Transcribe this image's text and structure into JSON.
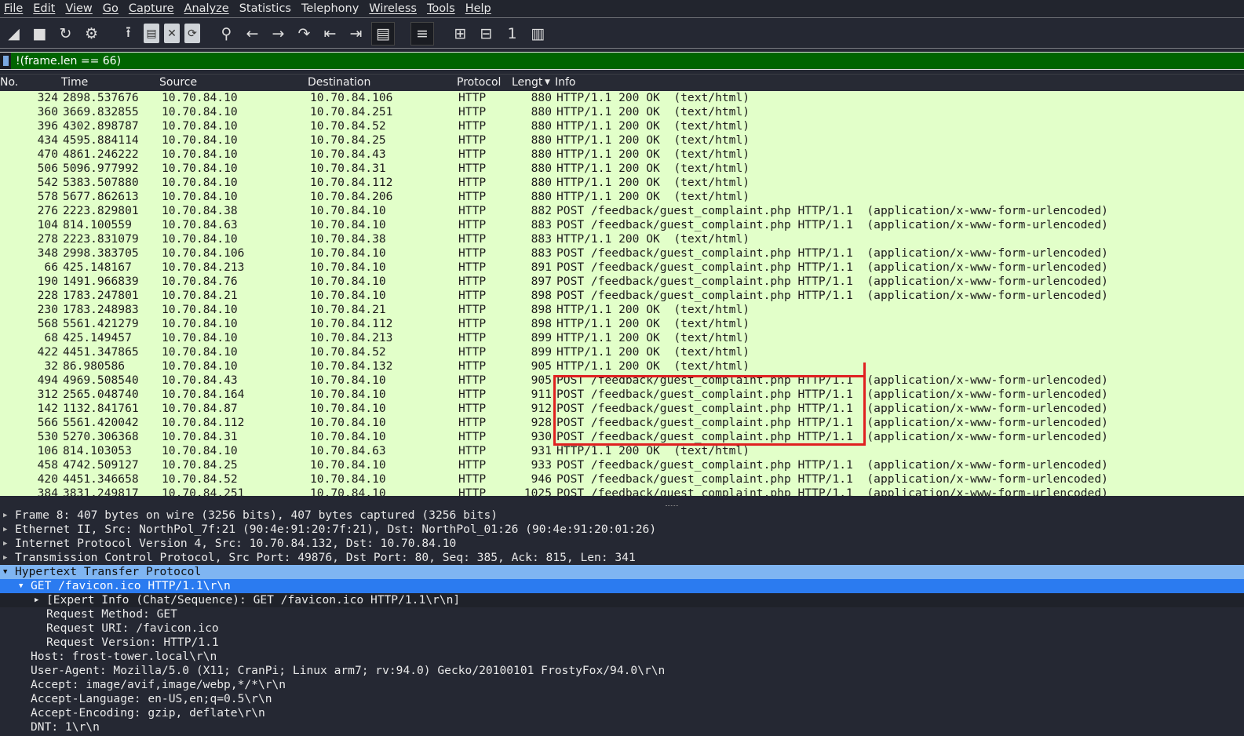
{
  "menu": [
    "File",
    "Edit",
    "View",
    "Go",
    "Capture",
    "Analyze",
    "Statistics",
    "Telephony",
    "Wireless",
    "Tools",
    "Help"
  ],
  "toolbar_icons": [
    "shark-fin-start-icon",
    "stop-icon",
    "restart-icon",
    "options-gear-icon",
    "open-file-icon",
    "file-icon",
    "close-file-icon",
    "reload-file-icon",
    "search-icon",
    "back-arrow-icon",
    "forward-arrow-icon",
    "go-to-packet-icon",
    "first-packet-icon",
    "last-packet-icon",
    "autoscroll-icon",
    "colorize-icon",
    "zoom-in-icon",
    "zoom-out-icon",
    "normal-size-icon",
    "resize-columns-icon"
  ],
  "filter": {
    "value": "!(frame.len == 66)"
  },
  "columns": {
    "no": "No.",
    "time": "Time",
    "source": "Source",
    "destination": "Destination",
    "protocol": "Protocol",
    "length": "Lengt",
    "info": "Info"
  },
  "packets": [
    [
      "324",
      "2898.537676",
      "10.70.84.10",
      "10.70.84.106",
      "HTTP",
      "880",
      "HTTP/1.1 200 OK  (text/html)"
    ],
    [
      "360",
      "3669.832855",
      "10.70.84.10",
      "10.70.84.251",
      "HTTP",
      "880",
      "HTTP/1.1 200 OK  (text/html)"
    ],
    [
      "396",
      "4302.898787",
      "10.70.84.10",
      "10.70.84.52",
      "HTTP",
      "880",
      "HTTP/1.1 200 OK  (text/html)"
    ],
    [
      "434",
      "4595.884114",
      "10.70.84.10",
      "10.70.84.25",
      "HTTP",
      "880",
      "HTTP/1.1 200 OK  (text/html)"
    ],
    [
      "470",
      "4861.246222",
      "10.70.84.10",
      "10.70.84.43",
      "HTTP",
      "880",
      "HTTP/1.1 200 OK  (text/html)"
    ],
    [
      "506",
      "5096.977992",
      "10.70.84.10",
      "10.70.84.31",
      "HTTP",
      "880",
      "HTTP/1.1 200 OK  (text/html)"
    ],
    [
      "542",
      "5383.507880",
      "10.70.84.10",
      "10.70.84.112",
      "HTTP",
      "880",
      "HTTP/1.1 200 OK  (text/html)"
    ],
    [
      "578",
      "5677.862613",
      "10.70.84.10",
      "10.70.84.206",
      "HTTP",
      "880",
      "HTTP/1.1 200 OK  (text/html)"
    ],
    [
      "276",
      "2223.829801",
      "10.70.84.38",
      "10.70.84.10",
      "HTTP",
      "882",
      "POST /feedback/guest_complaint.php HTTP/1.1  (application/x-www-form-urlencoded)"
    ],
    [
      "104",
      "814.100559",
      "10.70.84.63",
      "10.70.84.10",
      "HTTP",
      "883",
      "POST /feedback/guest_complaint.php HTTP/1.1  (application/x-www-form-urlencoded)"
    ],
    [
      "278",
      "2223.831079",
      "10.70.84.10",
      "10.70.84.38",
      "HTTP",
      "883",
      "HTTP/1.1 200 OK  (text/html)"
    ],
    [
      "348",
      "2998.383705",
      "10.70.84.106",
      "10.70.84.10",
      "HTTP",
      "883",
      "POST /feedback/guest_complaint.php HTTP/1.1  (application/x-www-form-urlencoded)"
    ],
    [
      "66",
      "425.148167",
      "10.70.84.213",
      "10.70.84.10",
      "HTTP",
      "891",
      "POST /feedback/guest_complaint.php HTTP/1.1  (application/x-www-form-urlencoded)"
    ],
    [
      "190",
      "1491.966839",
      "10.70.84.76",
      "10.70.84.10",
      "HTTP",
      "897",
      "POST /feedback/guest_complaint.php HTTP/1.1  (application/x-www-form-urlencoded)"
    ],
    [
      "228",
      "1783.247801",
      "10.70.84.21",
      "10.70.84.10",
      "HTTP",
      "898",
      "POST /feedback/guest_complaint.php HTTP/1.1  (application/x-www-form-urlencoded)"
    ],
    [
      "230",
      "1783.248983",
      "10.70.84.10",
      "10.70.84.21",
      "HTTP",
      "898",
      "HTTP/1.1 200 OK  (text/html)"
    ],
    [
      "568",
      "5561.421279",
      "10.70.84.10",
      "10.70.84.112",
      "HTTP",
      "898",
      "HTTP/1.1 200 OK  (text/html)"
    ],
    [
      "68",
      "425.149457",
      "10.70.84.10",
      "10.70.84.213",
      "HTTP",
      "899",
      "HTTP/1.1 200 OK  (text/html)"
    ],
    [
      "422",
      "4451.347865",
      "10.70.84.10",
      "10.70.84.52",
      "HTTP",
      "899",
      "HTTP/1.1 200 OK  (text/html)"
    ],
    [
      "32",
      "86.980586",
      "10.70.84.10",
      "10.70.84.132",
      "HTTP",
      "905",
      "HTTP/1.1 200 OK  (text/html)"
    ],
    [
      "494",
      "4969.508540",
      "10.70.84.43",
      "10.70.84.10",
      "HTTP",
      "905",
      "POST /feedback/guest_complaint.php HTTP/1.1  (application/x-www-form-urlencoded)"
    ],
    [
      "312",
      "2565.048740",
      "10.70.84.164",
      "10.70.84.10",
      "HTTP",
      "911",
      "POST /feedback/guest_complaint.php HTTP/1.1  (application/x-www-form-urlencoded)"
    ],
    [
      "142",
      "1132.841761",
      "10.70.84.87",
      "10.70.84.10",
      "HTTP",
      "912",
      "POST /feedback/guest_complaint.php HTTP/1.1  (application/x-www-form-urlencoded)"
    ],
    [
      "566",
      "5561.420042",
      "10.70.84.112",
      "10.70.84.10",
      "HTTP",
      "928",
      "POST /feedback/guest_complaint.php HTTP/1.1  (application/x-www-form-urlencoded)"
    ],
    [
      "530",
      "5270.306368",
      "10.70.84.31",
      "10.70.84.10",
      "HTTP",
      "930",
      "POST /feedback/guest_complaint.php HTTP/1.1  (application/x-www-form-urlencoded)"
    ],
    [
      "106",
      "814.103053",
      "10.70.84.10",
      "10.70.84.63",
      "HTTP",
      "931",
      "HTTP/1.1 200 OK  (text/html)"
    ],
    [
      "458",
      "4742.509127",
      "10.70.84.25",
      "10.70.84.10",
      "HTTP",
      "933",
      "POST /feedback/guest_complaint.php HTTP/1.1  (application/x-www-form-urlencoded)"
    ],
    [
      "420",
      "4451.346658",
      "10.70.84.52",
      "10.70.84.10",
      "HTTP",
      "946",
      "POST /feedback/guest_complaint.php HTTP/1.1  (application/x-www-form-urlencoded)"
    ],
    [
      "384",
      "3831.249817",
      "10.70.84.251",
      "10.70.84.10",
      "HTTP",
      "1025",
      "POST /feedback/guest_complaint.php HTTP/1.1  (application/x-www-form-urlencoded)"
    ]
  ],
  "details": [
    {
      "text": "Frame 8: 407 bytes on wire (3256 bits), 407 bytes captured (3256 bits)",
      "indent": 0,
      "arrow": "right"
    },
    {
      "text": "Ethernet II, Src: NorthPol_7f:21 (90:4e:91:20:7f:21), Dst: NorthPol_01:26 (90:4e:91:20:01:26)",
      "indent": 0,
      "arrow": "right"
    },
    {
      "text": "Internet Protocol Version 4, Src: 10.70.84.132, Dst: 10.70.84.10",
      "indent": 0,
      "arrow": "right"
    },
    {
      "text": "Transmission Control Protocol, Src Port: 49876, Dst Port: 80, Seq: 385, Ack: 815, Len: 341",
      "indent": 0,
      "arrow": "right"
    },
    {
      "text": "Hypertext Transfer Protocol",
      "indent": 0,
      "arrow": "down",
      "highlight": "parent"
    },
    {
      "text": "GET /favicon.ico HTTP/1.1\\r\\n",
      "indent": 1,
      "arrow": "down",
      "highlight": "selected"
    },
    {
      "text": "[Expert Info (Chat/Sequence): GET /favicon.ico HTTP/1.1\\r\\n]",
      "indent": 2,
      "arrow": "right",
      "highlight": "child"
    },
    {
      "text": "Request Method: GET",
      "indent": 2
    },
    {
      "text": "Request URI: /favicon.ico",
      "indent": 2
    },
    {
      "text": "Request Version: HTTP/1.1",
      "indent": 2
    },
    {
      "text": "Host: frost-tower.local\\r\\n",
      "indent": 1
    },
    {
      "text": "User-Agent: Mozilla/5.0 (X11; CranPi; Linux arm7; rv:94.0) Gecko/20100101 FrostyFox/94.0\\r\\n",
      "indent": 1
    },
    {
      "text": "Accept: image/avif,image/webp,*/*\\r\\n",
      "indent": 1
    },
    {
      "text": "Accept-Language: en-US,en;q=0.5\\r\\n",
      "indent": 1
    },
    {
      "text": "Accept-Encoding: gzip, deflate\\r\\n",
      "indent": 1
    },
    {
      "text": "DNT: 1\\r\\n",
      "indent": 1
    }
  ],
  "colors": {
    "row_bg": "#e2ffc9",
    "filter_bg": "#006400",
    "annotation": "#e02020",
    "selected": "#2b7bf0"
  }
}
